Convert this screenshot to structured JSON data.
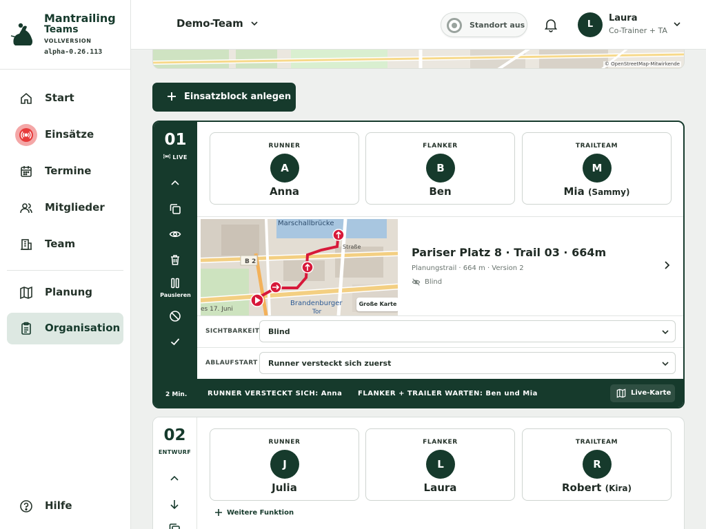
{
  "brand": {
    "title_line1": "Mantrailing",
    "title_line2": "Teams",
    "edition": "VOLLVERSION",
    "version": "alpha-0.26.113"
  },
  "nav": {
    "items": [
      {
        "label": "Start",
        "icon": "home-icon"
      },
      {
        "label": "Einsätze",
        "icon": "live-radio-icon"
      },
      {
        "label": "Termine",
        "icon": "calendar-icon"
      },
      {
        "label": "Mitglieder",
        "icon": "users-icon"
      },
      {
        "label": "Team",
        "icon": "building-icon"
      },
      {
        "label": "Planung",
        "icon": "map-icon"
      },
      {
        "label": "Organisation",
        "icon": "clipboard-icon"
      }
    ],
    "active": "Organisation",
    "help_label": "Hilfe"
  },
  "topbar": {
    "team": "Demo-Team",
    "location_status": "Standort aus",
    "user_initial": "L",
    "user_name": "Laura",
    "user_role": "Co-Trainer + TA"
  },
  "map_attribution": "© OpenStreetMap-Mitwirkende",
  "add_block_label": "Einsatzblock anlegen",
  "blocks": [
    {
      "number": "01",
      "status": "LIVE",
      "pause_label": "Pausieren",
      "roles": [
        {
          "title": "RUNNER",
          "initial": "A",
          "name": "Anna",
          "dog": ""
        },
        {
          "title": "FLANKER",
          "initial": "B",
          "name": "Ben",
          "dog": ""
        },
        {
          "title": "TRAILTEAM",
          "initial": "M",
          "name": "Mia",
          "dog": "(Sammy)"
        }
      ],
      "trail": {
        "title": "Pariser Platz 8 · Trail 03 · 664m",
        "meta": "Planungstrail · 664 m · Version 2",
        "visibility": "Blind",
        "big_map_label": "Große Karte",
        "map_labels": {
          "bridge": "Marschallbrücke",
          "road": "B 2",
          "gate": "Brandenburger",
          "gate2": "Tor",
          "street": "es 17. Juni",
          "strasse": "Straße"
        }
      },
      "fields": [
        {
          "label": "SICHTBARKEIT",
          "value": "Blind"
        },
        {
          "label": "ABLAUFSTART",
          "value": "Runner versteckt sich zuerst"
        }
      ],
      "footer": {
        "duration": "2 Min.",
        "step1": "RUNNER VERSTECKT SICH: Anna",
        "step2": "FLANKER + TRAILER WARTEN: Ben und Mia",
        "live_map_label": "Live-Karte"
      }
    },
    {
      "number": "02",
      "status": "ENTWURF",
      "roles": [
        {
          "title": "RUNNER",
          "initial": "J",
          "name": "Julia",
          "dog": ""
        },
        {
          "title": "FLANKER",
          "initial": "L",
          "name": "Laura",
          "dog": ""
        },
        {
          "title": "TRAILTEAM",
          "initial": "R",
          "name": "Robert",
          "dog": "(Kira)"
        }
      ],
      "more_label": "Weitere Funktion"
    }
  ],
  "colors": {
    "brand": "#163a2c",
    "live": "#e73b3b",
    "route": "#d7193a"
  }
}
